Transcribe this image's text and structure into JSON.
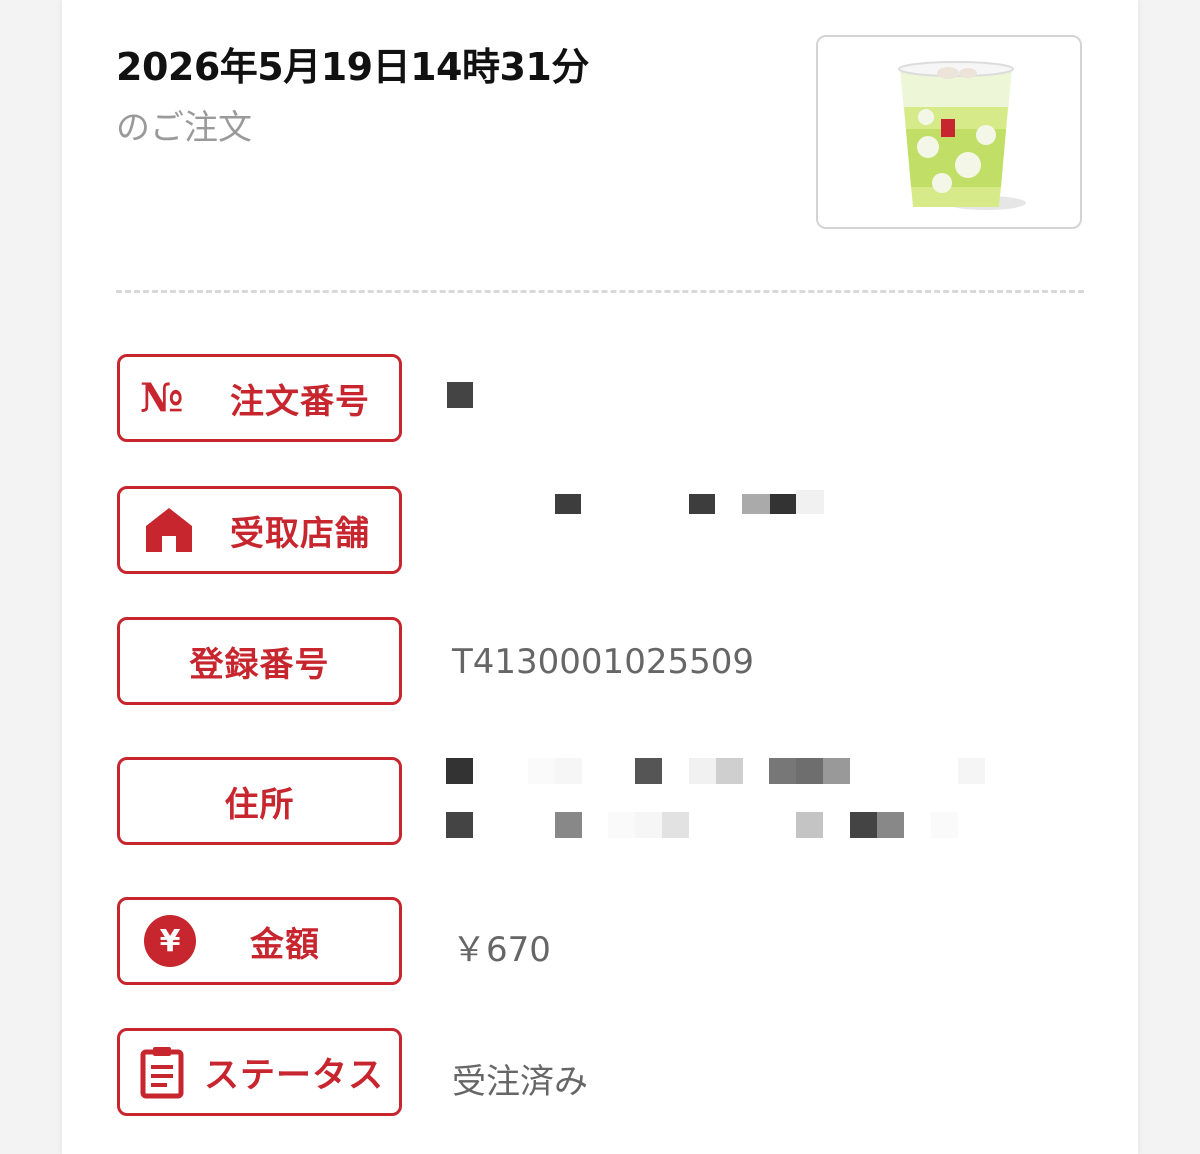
{
  "order": {
    "datetime": "2026年5月19日14時31分",
    "suffix": "のご注文"
  },
  "rows": [
    {
      "icon": "number-sign-icon",
      "label": "注文番号",
      "value": ""
    },
    {
      "icon": "home-icon",
      "label": "受取店舗",
      "value": ""
    },
    {
      "icon": "",
      "label": "登録番号",
      "value": "T4130001025509"
    },
    {
      "icon": "",
      "label": "住所",
      "value": ""
    },
    {
      "icon": "yen-icon",
      "label": "金額",
      "value": "￥670"
    },
    {
      "icon": "clipboard-icon",
      "label": "ステータス",
      "value": "受注済み"
    }
  ],
  "icons": {
    "no_mark": "№",
    "yen": "¥"
  },
  "colors": {
    "accent": "#c8262f",
    "value_text": "#666666",
    "sub_text": "#9a9a9a"
  }
}
